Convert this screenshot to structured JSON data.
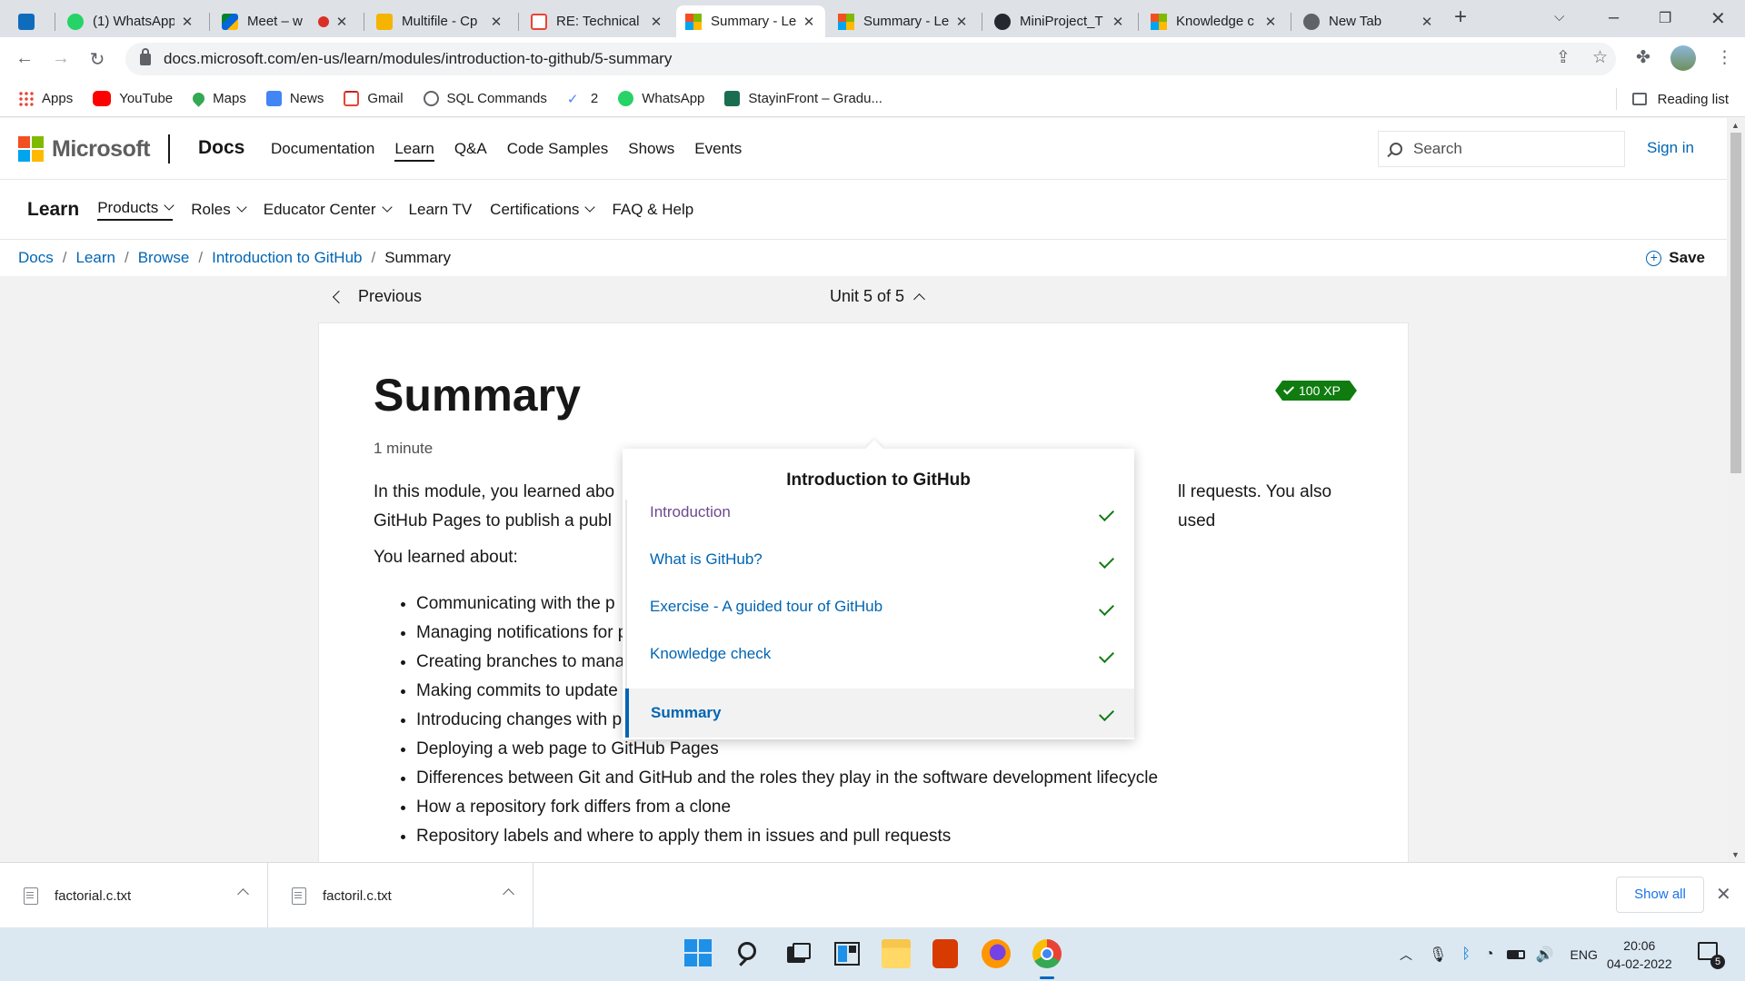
{
  "browser": {
    "tabs": [
      {
        "title": "",
        "icon": "outlook-icon"
      },
      {
        "title": "(1) WhatsApp",
        "icon": "whatsapp-icon"
      },
      {
        "title": "Meet – w",
        "icon": "google-meet-icon"
      },
      {
        "title": "Multifile - Cp",
        "icon": "codepad-icon"
      },
      {
        "title": "RE: Technical",
        "icon": "gmail-icon"
      },
      {
        "title": "Summary - Le",
        "icon": "microsoft-icon"
      },
      {
        "title": "Summary - Le",
        "icon": "microsoft-icon"
      },
      {
        "title": "MiniProject_T",
        "icon": "github-icon"
      },
      {
        "title": "Knowledge c",
        "icon": "microsoft-icon"
      },
      {
        "title": "New Tab",
        "icon": "chrome-newtab-icon"
      }
    ],
    "active_tab_index": 5,
    "url": "docs.microsoft.com/en-us/learn/modules/introduction-to-github/5-summary",
    "bookmarks": [
      {
        "label": "Apps",
        "icon": "apps-grid-icon"
      },
      {
        "label": "YouTube",
        "icon": "youtube-icon"
      },
      {
        "label": "Maps",
        "icon": "maps-icon"
      },
      {
        "label": "News",
        "icon": "google-news-icon"
      },
      {
        "label": "Gmail",
        "icon": "gmail-icon"
      },
      {
        "label": "SQL Commands",
        "icon": "globe-icon"
      },
      {
        "label": "2",
        "icon": "feather-icon"
      },
      {
        "label": "WhatsApp",
        "icon": "whatsapp-icon"
      },
      {
        "label": "StayinFront – Gradu...",
        "icon": "stayinfront-icon"
      }
    ],
    "reading_list": "Reading list"
  },
  "docs": {
    "brand": "Microsoft",
    "site": "Docs",
    "top_nav": [
      "Documentation",
      "Learn",
      "Q&A",
      "Code Samples",
      "Shows",
      "Events"
    ],
    "search_placeholder": "Search",
    "sign_in": "Sign in",
    "learn_brand": "Learn",
    "sub_nav": [
      {
        "label": "Products",
        "dropdown": true
      },
      {
        "label": "Roles",
        "dropdown": true
      },
      {
        "label": "Educator Center",
        "dropdown": true
      },
      {
        "label": "Learn TV",
        "dropdown": false
      },
      {
        "label": "Certifications",
        "dropdown": true
      },
      {
        "label": "FAQ & Help",
        "dropdown": false
      }
    ],
    "breadcrumb": [
      "Docs",
      "Learn",
      "Browse",
      "Introduction to GitHub",
      "Summary"
    ],
    "save": "Save",
    "previous": "Previous",
    "unit": "Unit 5 of 5"
  },
  "article": {
    "title": "Summary",
    "xp": "100 XP",
    "duration": "1 minute",
    "paragraph_left": "In this module, you learned abo",
    "paragraph_right": "ll requests. You also used",
    "paragraph_line2": "GitHub Pages to publish a publ",
    "learned_label": "You learned about:",
    "bullets": [
      "Communicating with the p",
      "Managing notifications for project events",
      "Creating branches to manage work in parallel",
      "Making commits to update project source",
      "Introducing changes with pull requests",
      "Deploying a web page to GitHub Pages",
      "Differences between Git and GitHub and the roles they play in the software development lifecycle",
      "How a repository fork differs from a clone",
      "Repository labels and where to apply them in issues and pull requests"
    ]
  },
  "unit_menu": {
    "title": "Introduction to GitHub",
    "items": [
      {
        "label": "Introduction",
        "completed": true
      },
      {
        "label": "What is GitHub?",
        "completed": true
      },
      {
        "label": "Exercise - A guided tour of GitHub",
        "completed": true
      },
      {
        "label": "Knowledge check",
        "completed": true
      },
      {
        "label": "Summary",
        "completed": true,
        "current": true
      }
    ]
  },
  "downloads": {
    "files": [
      "factorial.c.txt",
      "factoril.c.txt"
    ],
    "show_all": "Show all"
  },
  "taskbar": {
    "language": "ENG",
    "time": "20:06",
    "date": "04-02-2022",
    "notifications": "5"
  },
  "colors": {
    "link": "#0065b3",
    "success": "#107c10",
    "tab_strip": "#dee1e6",
    "taskbar": "#dbe8f1"
  }
}
